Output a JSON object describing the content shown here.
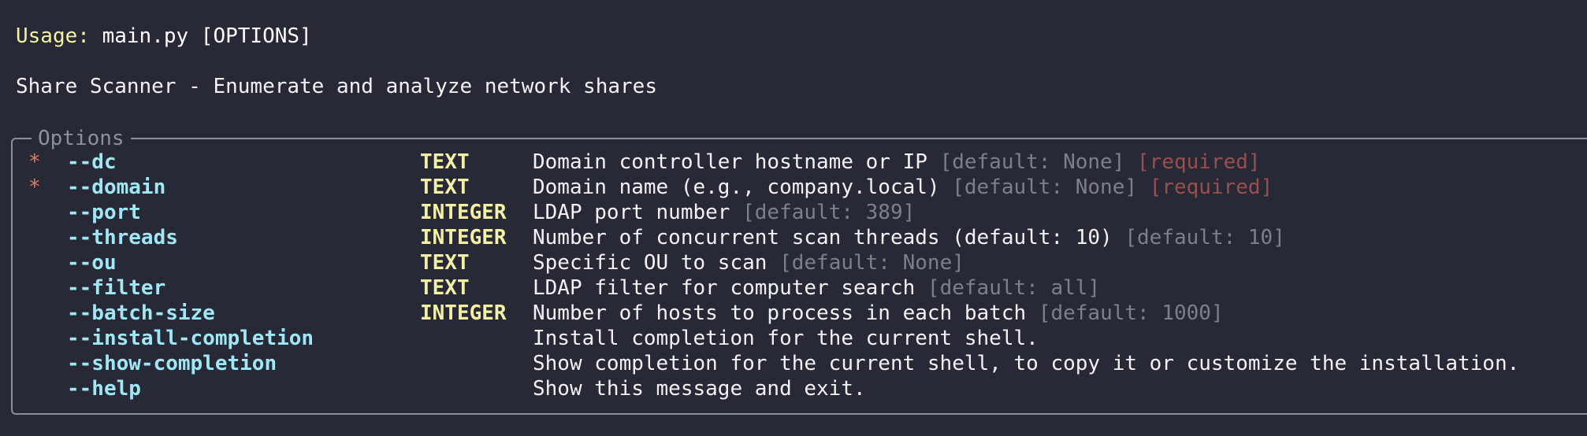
{
  "usage": {
    "label": "Usage:",
    "command": " main.py [OPTIONS]"
  },
  "description": "Share Scanner - Enumerate and analyze network shares",
  "options_title": "Options",
  "options": [
    {
      "required_mark": "*",
      "name": "--dc",
      "type": "TEXT",
      "help": "Domain controller hostname or IP",
      "default": "[default: None]",
      "required": "[required]"
    },
    {
      "required_mark": "*",
      "name": "--domain",
      "type": "TEXT",
      "help": "Domain name (e.g., company.local)",
      "default": "[default: None]",
      "required": "[required]"
    },
    {
      "required_mark": "",
      "name": "--port",
      "type": "INTEGER",
      "help": "LDAP port number",
      "default": "[default: 389]",
      "required": ""
    },
    {
      "required_mark": "",
      "name": "--threads",
      "type": "INTEGER",
      "help": "Number of concurrent scan threads (default: 10)",
      "default": "[default: 10]",
      "required": ""
    },
    {
      "required_mark": "",
      "name": "--ou",
      "type": "TEXT",
      "help": "Specific OU to scan",
      "default": "[default: None]",
      "required": ""
    },
    {
      "required_mark": "",
      "name": "--filter",
      "type": "TEXT",
      "help": "LDAP filter for computer search",
      "default": "[default: all]",
      "required": ""
    },
    {
      "required_mark": "",
      "name": "--batch-size",
      "type": "INTEGER",
      "help": "Number of hosts to process in each batch",
      "default": "[default: 1000]",
      "required": ""
    },
    {
      "required_mark": "",
      "name": "--install-completion",
      "type": "",
      "help": "Install completion for the current shell.",
      "default": "",
      "required": ""
    },
    {
      "required_mark": "",
      "name": "--show-completion",
      "type": "",
      "help": "Show completion for the current shell, to copy it or customize the installation.",
      "default": "",
      "required": ""
    },
    {
      "required_mark": "",
      "name": "--help",
      "type": "",
      "help": "Show this message and exit.",
      "default": "",
      "required": ""
    }
  ],
  "colors": {
    "background": "#272936",
    "usage_label": "#f4f1a4",
    "option_name": "#9fe7f5",
    "type": "#f4f1a4",
    "required_star": "#e07a5f",
    "default_text": "#7d7f89",
    "required_text": "#9a4f4f",
    "border": "#8d8f99"
  }
}
